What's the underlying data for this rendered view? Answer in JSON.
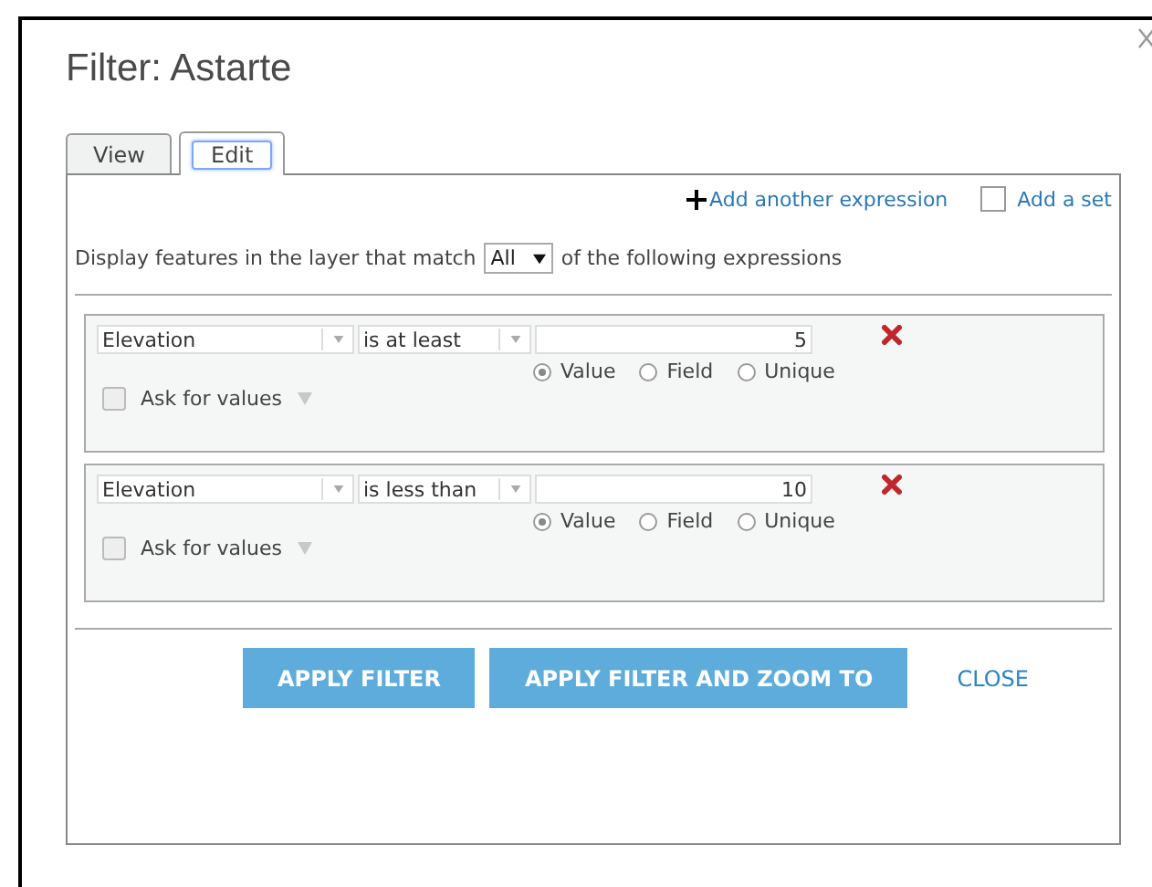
{
  "dialog": {
    "title": "Filter: Astarte"
  },
  "tabs": [
    {
      "label": "View",
      "selected": false
    },
    {
      "label": "Edit",
      "selected": true
    }
  ],
  "add_expression": {
    "label": "Add another expression"
  },
  "add_set": {
    "label": "Add a set",
    "checked": false
  },
  "match": {
    "before": "Display features in the layer that match",
    "value": "All",
    "after": "of the following expressions"
  },
  "expressions": [
    {
      "field": "Elevation",
      "operator": "is at least",
      "value": "5",
      "sources": [
        {
          "label": "Value",
          "selected": true
        },
        {
          "label": "Field",
          "selected": false
        },
        {
          "label": "Unique",
          "selected": false
        }
      ],
      "ask": {
        "label": "Ask for values",
        "checked": false
      }
    },
    {
      "field": "Elevation",
      "operator": "is less than",
      "value": "10",
      "sources": [
        {
          "label": "Value",
          "selected": true
        },
        {
          "label": "Field",
          "selected": false
        },
        {
          "label": "Unique",
          "selected": false
        }
      ],
      "ask": {
        "label": "Ask for values",
        "checked": false
      }
    }
  ],
  "buttons": [
    {
      "label": "APPLY FILTER",
      "kind": "primary"
    },
    {
      "label": "APPLY FILTER AND ZOOM TO",
      "kind": "primary"
    },
    {
      "label": "CLOSE",
      "kind": "link"
    }
  ]
}
